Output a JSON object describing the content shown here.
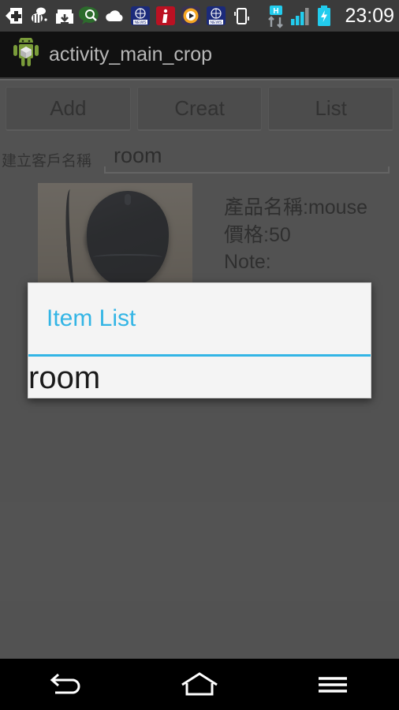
{
  "statusbar": {
    "time": "23:09",
    "icons": [
      {
        "name": "medical-cross-icon",
        "label": "medical cross"
      },
      {
        "name": "bee-app-icon",
        "label": "bee"
      },
      {
        "name": "archive-download-icon",
        "label": "archive download"
      },
      {
        "name": "search-bubble-icon",
        "label": "search"
      },
      {
        "name": "cloud-upload-icon",
        "label": "cloud"
      },
      {
        "name": "news-app-icon",
        "label": "NEWS"
      },
      {
        "name": "info-app-icon",
        "label": "i"
      },
      {
        "name": "media-play-icon",
        "label": "play"
      },
      {
        "name": "news-app-icon-2",
        "label": "NEWS"
      },
      {
        "name": "vibrate-icon",
        "label": "vibrate"
      },
      {
        "name": "hspa-data-icon",
        "label": "H"
      },
      {
        "name": "signal-bars-icon",
        "label": "signal"
      },
      {
        "name": "battery-charging-icon",
        "label": "battery"
      }
    ],
    "network_type": "H",
    "accent_cyan": "#22ccee"
  },
  "titlebar": {
    "app_icon": "android-robot-icon",
    "title": "activity_main_crop"
  },
  "main": {
    "buttons": [
      {
        "name": "add-button",
        "label": "Add"
      },
      {
        "name": "creat-button",
        "label": "Creat"
      },
      {
        "name": "list-button",
        "label": "List"
      }
    ],
    "customer_field": {
      "label": "建立客戶名稱",
      "value": "room",
      "placeholder": ""
    },
    "item": {
      "photo_alt": "mouse-photo",
      "product_name": "產品名稱:mouse",
      "price": "價格:50",
      "note": "Note:"
    }
  },
  "dialog": {
    "title": "Item List",
    "accent": "#33b5e5",
    "items": [
      {
        "label": "room"
      }
    ]
  },
  "navbar": {
    "back": "back-icon",
    "home": "home-icon",
    "menu": "menu-icon"
  }
}
